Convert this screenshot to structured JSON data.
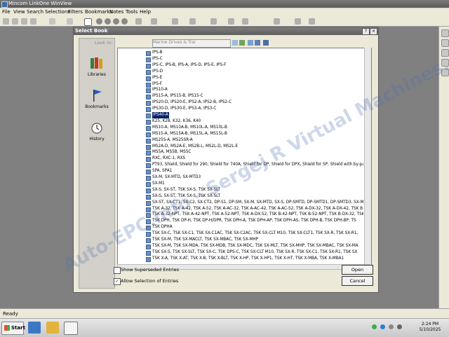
{
  "app": {
    "title": "Mincom LinkOne WinView",
    "menu": [
      "File",
      "View",
      "Search",
      "Selections",
      "Filters",
      "Bookmarks",
      "Notes",
      "Tools",
      "Help"
    ],
    "status": "Ready"
  },
  "dialog": {
    "title": "Select Book",
    "look_in_label": "Look In:",
    "look_in_value": "Marine Drives & Trar",
    "places": [
      {
        "label": "Libraries",
        "icon": "libraries-icon"
      },
      {
        "label": "Bookmarks",
        "icon": "bookmark-flag-icon"
      },
      {
        "label": "History",
        "icon": "history-clock-icon"
      }
    ],
    "books": [
      "IPS-B",
      "IPS-C",
      "IPS-C, IPS-B, IPS-A, IPS-D, IPS-E, IPS-F",
      "IPS-D",
      "IPS-E",
      "IPS-F",
      "IPS10-A",
      "IPS15-A, IPS15-B, IPS15-C",
      "IPS20-D, IPS20-E, IPS2-A, IPS2-B, IPS2-C",
      "IPS30-D, IPS30-E, IPS3-A, IPS3-C",
      "IPS40-A",
      "K25, K28, K32, K36, K40",
      "MS10-A, MS10A-B, MS10L-A, MS10L-B",
      "MS15-A, MS15A-B, MS15L-A, MS15L-B",
      "MS25S-A, MS25SR-A",
      "MS2A-D, MS2A-E, MS2B-L, MS2L-D, MS2L-E",
      "MS5A, MS5B, MS5C",
      "RXC, RXC-1, RXS",
      "PT93, Shield, Shield for 290, Shield for 740A, Shield for DP, Shield for DPX, Shield for SP, Shield with by-pass, Shie",
      "SPA, SPA1",
      "SX-M, SX-MTD, SX-MTD3",
      "SX-M1",
      "SX-S, SX-ST, TSK SX-S, TSK SX-SLT",
      "SX-S, SX-ST, TSK SX-S, TSK SX-SLT",
      "SX-ST, SX-CT1, SX-C2, SX-CT2, DP-S1, DP-SM, SX-M, SX-MTD, SX-S, DP-SMTD, DP-SMTD1, DP-SMTD3, SX-M",
      "TSK A-32, TSK A-42, TSK A-52, TSK A-AC-32, TSK A-AC-42, TSK A-AC-52, TSK A-DX-32, TSK A-DX-42, TSK B",
      "TSK A-32-NPT, TSK A-42-NPT, TSK A-52-NPT, TSK A-DX-52, TSK B-42-NPT, TSK B-52-NPT, TSK B-DX-32, TSK B-DX-42, TSK",
      "TSK DPH, TSK DP-H, TSK DP-H/DPR, TSK DPH-A, TSK DPH-AP, TSK DPH-AS, TSK DPH-B, TSK DPH-BP, TS",
      "TSK DPHA",
      "TSK SX-C, TSK SX-C1, TSK SX-C1AC, TSK SX-C2AC, TSK SX-CLT M10, TSK SX-CLT1, TSK SX-R, TSK SX-R1,",
      "TSK SX-M, TSK SX-MACLT, TSK SX-MBAC, TSK SX-MHP",
      "TSK SX-M, TSK SX-MDA, TSK SX-MDB, TSK SX-MDC, TSK SX-MLT, TSK SX-MHP, TSK SX-MBAC, TSK SX-MA",
      "TSK SX-S, TSK SX-SLT, TSK SX-C, TSK DPS-C, TSK SX-CLT M10, TSK SX-R, TSK SX-C1, TSK SX-R1, TSK SX",
      "TSK X-A, TSK X-AT, TSK X-B, TSK X-BLT, TSK X-HP, TSK X-HP1, TSK X-HT, TSK X-MBA, TSK X-MBA1"
    ],
    "selected_book": "IPS40-A",
    "show_superseded_label": "Show Superseded Entries",
    "allow_selection_label": "Allow Selection of Entries",
    "show_superseded_checked": false,
    "allow_selection_checked": true,
    "open_label": "Open",
    "cancel_label": "Cancel"
  },
  "taskbar": {
    "start_label": "Start",
    "time": "2:24 PM",
    "date": "5/10/2025"
  },
  "watermark": "Auto-EPC.info - Sergej R Virtual Machines."
}
